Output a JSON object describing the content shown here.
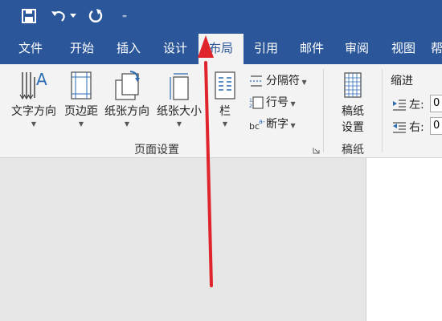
{
  "quick_access": {
    "more": "⁼"
  },
  "tabs": [
    {
      "label": "文件"
    },
    {
      "label": "开始"
    },
    {
      "label": "插入"
    },
    {
      "label": "设计"
    },
    {
      "label": "布局"
    },
    {
      "label": "引用"
    },
    {
      "label": "邮件"
    },
    {
      "label": "审阅"
    },
    {
      "label": "视图"
    },
    {
      "label": "帮"
    }
  ],
  "page_setup": {
    "text_direction": "文字方向",
    "margins": "页边距",
    "orientation": "纸张方向",
    "size": "纸张大小",
    "columns": "栏",
    "breaks": "分隔符",
    "line_numbers": "行号",
    "hyphenation": "断字",
    "group_label": "页面设置"
  },
  "manuscript": {
    "button": "稿纸设置",
    "line1": "稿纸",
    "line2": "设置",
    "group_label": "稿纸"
  },
  "indent": {
    "title": "缩进",
    "left_label": "左:",
    "left_value": "0",
    "right_label": "右:",
    "right_value": "0"
  },
  "colors": {
    "accent": "#2b579a",
    "arrow": "#e0242b"
  }
}
